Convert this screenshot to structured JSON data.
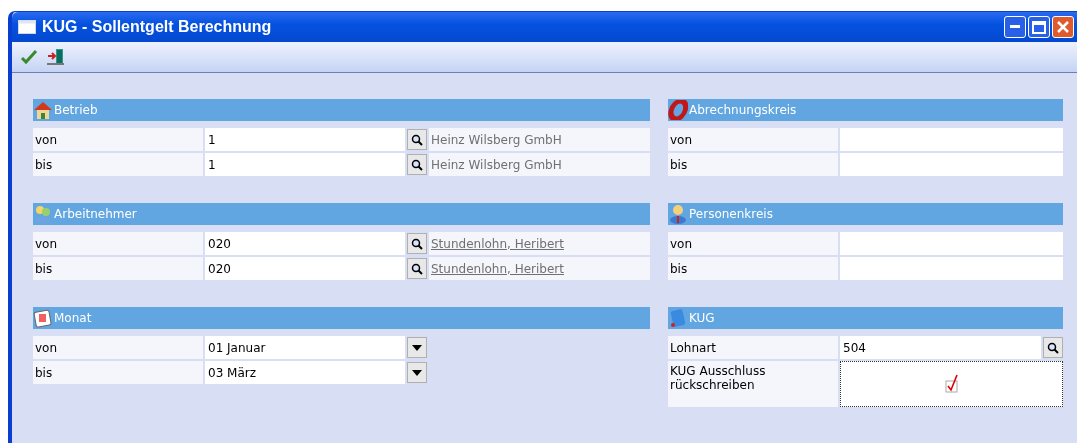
{
  "window": {
    "title": "KUG - Sollentgelt Berechnung"
  },
  "columns": [
    {
      "sections": [
        {
          "title": "Betrieb",
          "rows": [
            {
              "kind": "lookup",
              "label": "von",
              "value": "1",
              "name": "Heinz Wilsberg GmbH",
              "linked": false
            },
            {
              "kind": "lookup",
              "label": "bis",
              "value": "1",
              "name": "Heinz Wilsberg GmbH",
              "linked": false
            }
          ]
        },
        {
          "title": "Arbeitnehmer",
          "rows": [
            {
              "kind": "lookup",
              "label": "von",
              "value": "020",
              "name": "Stundenlohn, Heribert",
              "linked": true
            },
            {
              "kind": "lookup",
              "label": "bis",
              "value": "020",
              "name": "Stundenlohn, Heribert",
              "linked": true
            }
          ]
        },
        {
          "title": "Monat",
          "rows": [
            {
              "kind": "dropdown",
              "label": "von",
              "value": "01 Januar"
            },
            {
              "kind": "dropdown",
              "label": "bis",
              "value": "03 März"
            }
          ]
        }
      ]
    },
    {
      "sections": [
        {
          "title": "Abrechnungskreis",
          "rows": [
            {
              "kind": "text",
              "label": "von"
            },
            {
              "kind": "text",
              "label": "bis"
            }
          ]
        },
        {
          "title": "Personenkreis",
          "rows": [
            {
              "kind": "text",
              "label": "von"
            },
            {
              "kind": "text",
              "label": "bis"
            }
          ]
        },
        {
          "title": "KUG",
          "rows": [
            {
              "kind": "search",
              "label": "Lohnart",
              "value": "504"
            },
            {
              "kind": "checkbox",
              "label": "KUG Ausschluss rückschreiben",
              "checked": true
            }
          ]
        }
      ]
    }
  ]
}
